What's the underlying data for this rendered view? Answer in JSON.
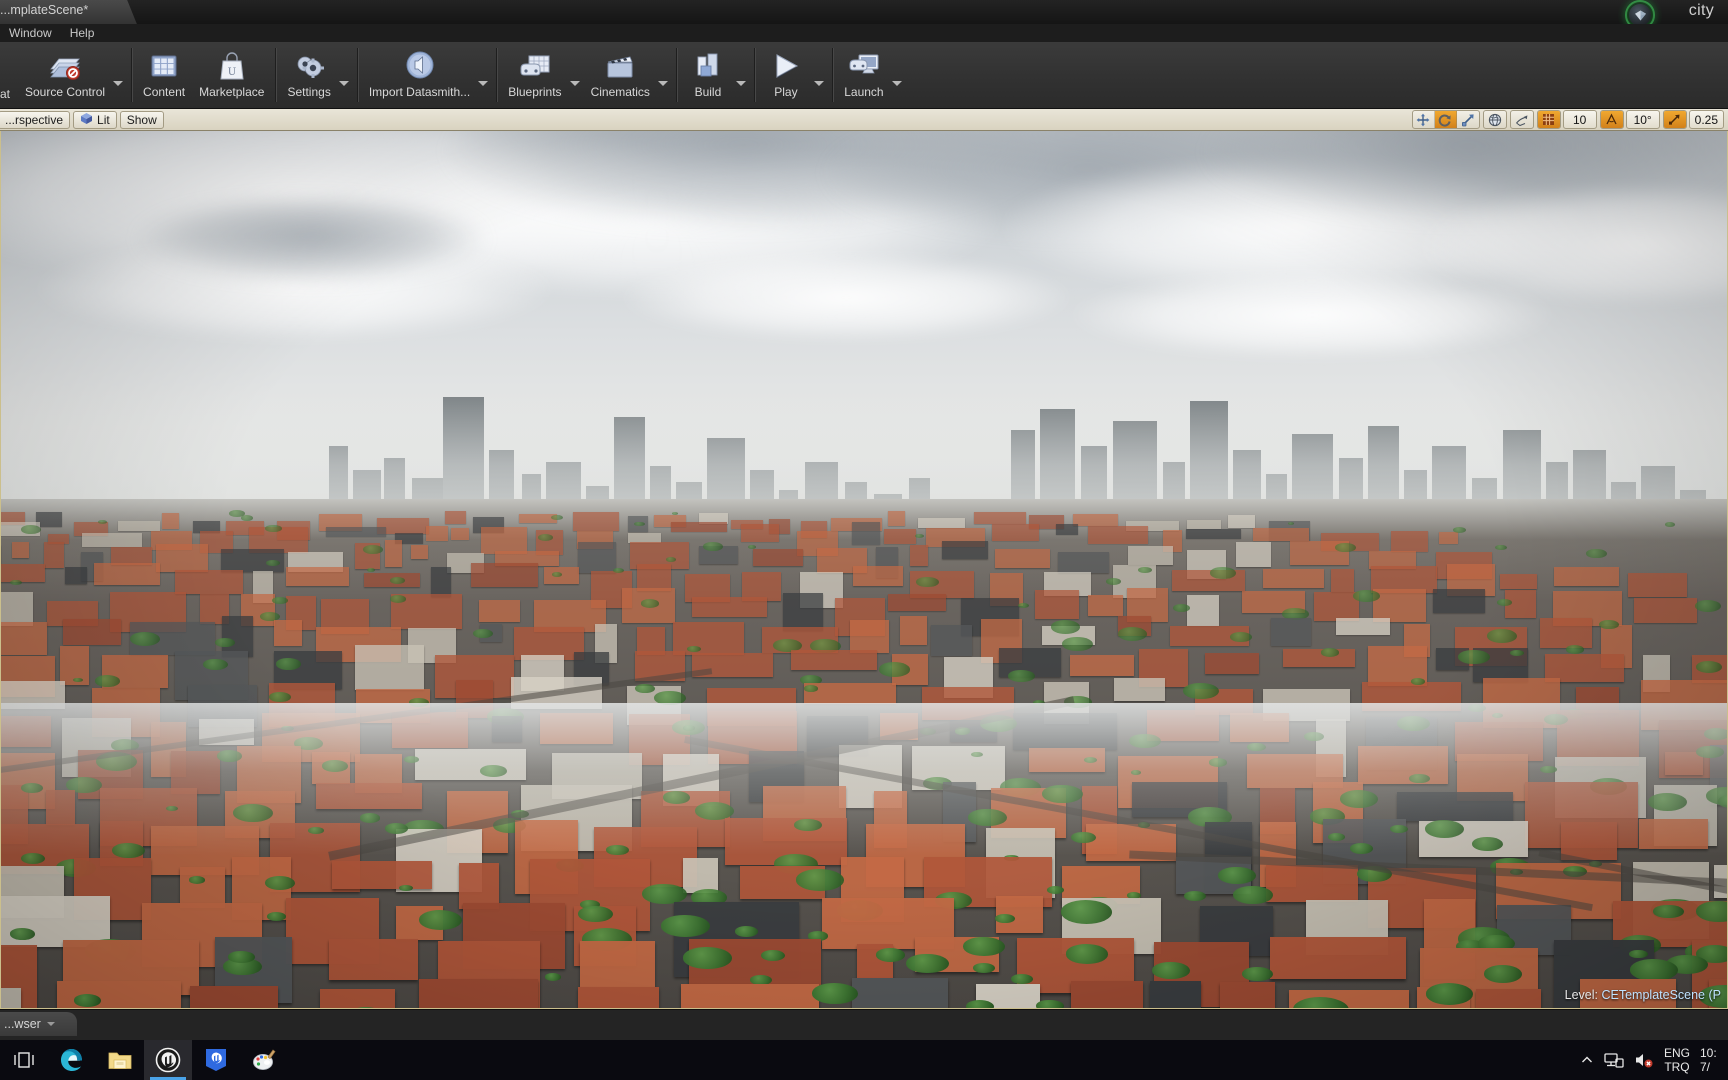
{
  "window": {
    "tab_title": "...mplateScene*",
    "app_title": "city",
    "logo_icon": "unreal-engine-logo-icon"
  },
  "menubar": {
    "items": [
      {
        "label": "Window",
        "name": "menu-window"
      },
      {
        "label": "Help",
        "name": "menu-help"
      }
    ]
  },
  "toolbar": {
    "buttons": [
      {
        "label": "Source Control",
        "icon": "source-control-icon",
        "caret": true,
        "name": "toolbar-source-control"
      },
      {
        "label": "Content",
        "icon": "content-browser-icon",
        "caret": false,
        "name": "toolbar-content"
      },
      {
        "label": "Marketplace",
        "icon": "marketplace-bag-icon",
        "caret": false,
        "name": "toolbar-marketplace"
      },
      {
        "label": "Settings",
        "icon": "settings-gear-icon",
        "caret": true,
        "name": "toolbar-settings"
      },
      {
        "label": "Import Datasmith...",
        "icon": "datasmith-icon",
        "caret": true,
        "name": "toolbar-import-datasmith"
      },
      {
        "label": "Blueprints",
        "icon": "blueprints-icon",
        "caret": true,
        "name": "toolbar-blueprints"
      },
      {
        "label": "Cinematics",
        "icon": "cinematics-clapper-icon",
        "caret": true,
        "name": "toolbar-cinematics"
      },
      {
        "label": "Build",
        "icon": "build-icon",
        "caret": true,
        "name": "toolbar-build"
      },
      {
        "label": "Play",
        "icon": "play-triangle-icon",
        "caret": true,
        "name": "toolbar-play"
      },
      {
        "label": "Launch",
        "icon": "launch-icon",
        "caret": true,
        "name": "toolbar-launch"
      }
    ]
  },
  "viewport_toolbar": {
    "left": [
      {
        "label": "...rspective",
        "icon": null,
        "name": "viewport-camera-mode"
      },
      {
        "label": "Lit",
        "icon": "lit-cube-icon",
        "name": "viewport-view-mode"
      },
      {
        "label": "Show",
        "icon": null,
        "name": "viewport-show-menu"
      }
    ],
    "transform_tools": [
      {
        "icon": "translate-arrows-icon",
        "active": false,
        "name": "tool-translate"
      },
      {
        "icon": "rotate-icon",
        "active": true,
        "name": "tool-rotate"
      },
      {
        "icon": "scale-icon",
        "active": false,
        "name": "tool-scale"
      }
    ],
    "coord_system": {
      "icon": "world-globe-icon",
      "active": false,
      "name": "tool-coordinate-system"
    },
    "surface_snap": {
      "icon": "surface-snap-icon",
      "active": false,
      "name": "tool-surface-snapping"
    },
    "grid_snap": {
      "icon": "grid-snap-icon",
      "active": true,
      "value": "10",
      "name": "tool-grid-snap"
    },
    "rotation_snap": {
      "icon": "rotation-snap-icon",
      "active": true,
      "value": "10°",
      "name": "tool-rotation-snap"
    },
    "scale_snap": {
      "icon": "scale-snap-icon",
      "active": true,
      "value": "0.25",
      "name": "tool-scale-snap"
    }
  },
  "viewport": {
    "level_key": "Level:",
    "level_value": "CETemplateScene (P"
  },
  "dock": {
    "tab_label": "...wser"
  },
  "taskbar": {
    "items": [
      {
        "icon": "task-view-icon",
        "name": "taskbar-task-view",
        "active": false
      },
      {
        "icon": "edge-browser-icon",
        "name": "taskbar-edge",
        "active": false
      },
      {
        "icon": "file-explorer-icon",
        "name": "taskbar-file-explorer",
        "active": false
      },
      {
        "icon": "unreal-engine-icon",
        "name": "taskbar-unreal-engine",
        "active": true
      },
      {
        "icon": "epic-launcher-icon",
        "name": "taskbar-epic-launcher",
        "active": false
      },
      {
        "icon": "paint-app-icon",
        "name": "taskbar-paint",
        "active": false
      }
    ],
    "tray": {
      "chevron_icon": "show-hidden-icons-chevron",
      "network_icon": "network-icon",
      "volume_icon": "volume-muted-icon",
      "lang_line1": "ENG",
      "lang_line2": "TRQ",
      "clock_line1": "10:",
      "clock_line2": "7/"
    }
  },
  "colors": {
    "accent_orange": "#e09a28",
    "toolbar_cream": "#ddd8c8",
    "panel_dark": "#323232",
    "ue_green": "#3cdc5a"
  }
}
